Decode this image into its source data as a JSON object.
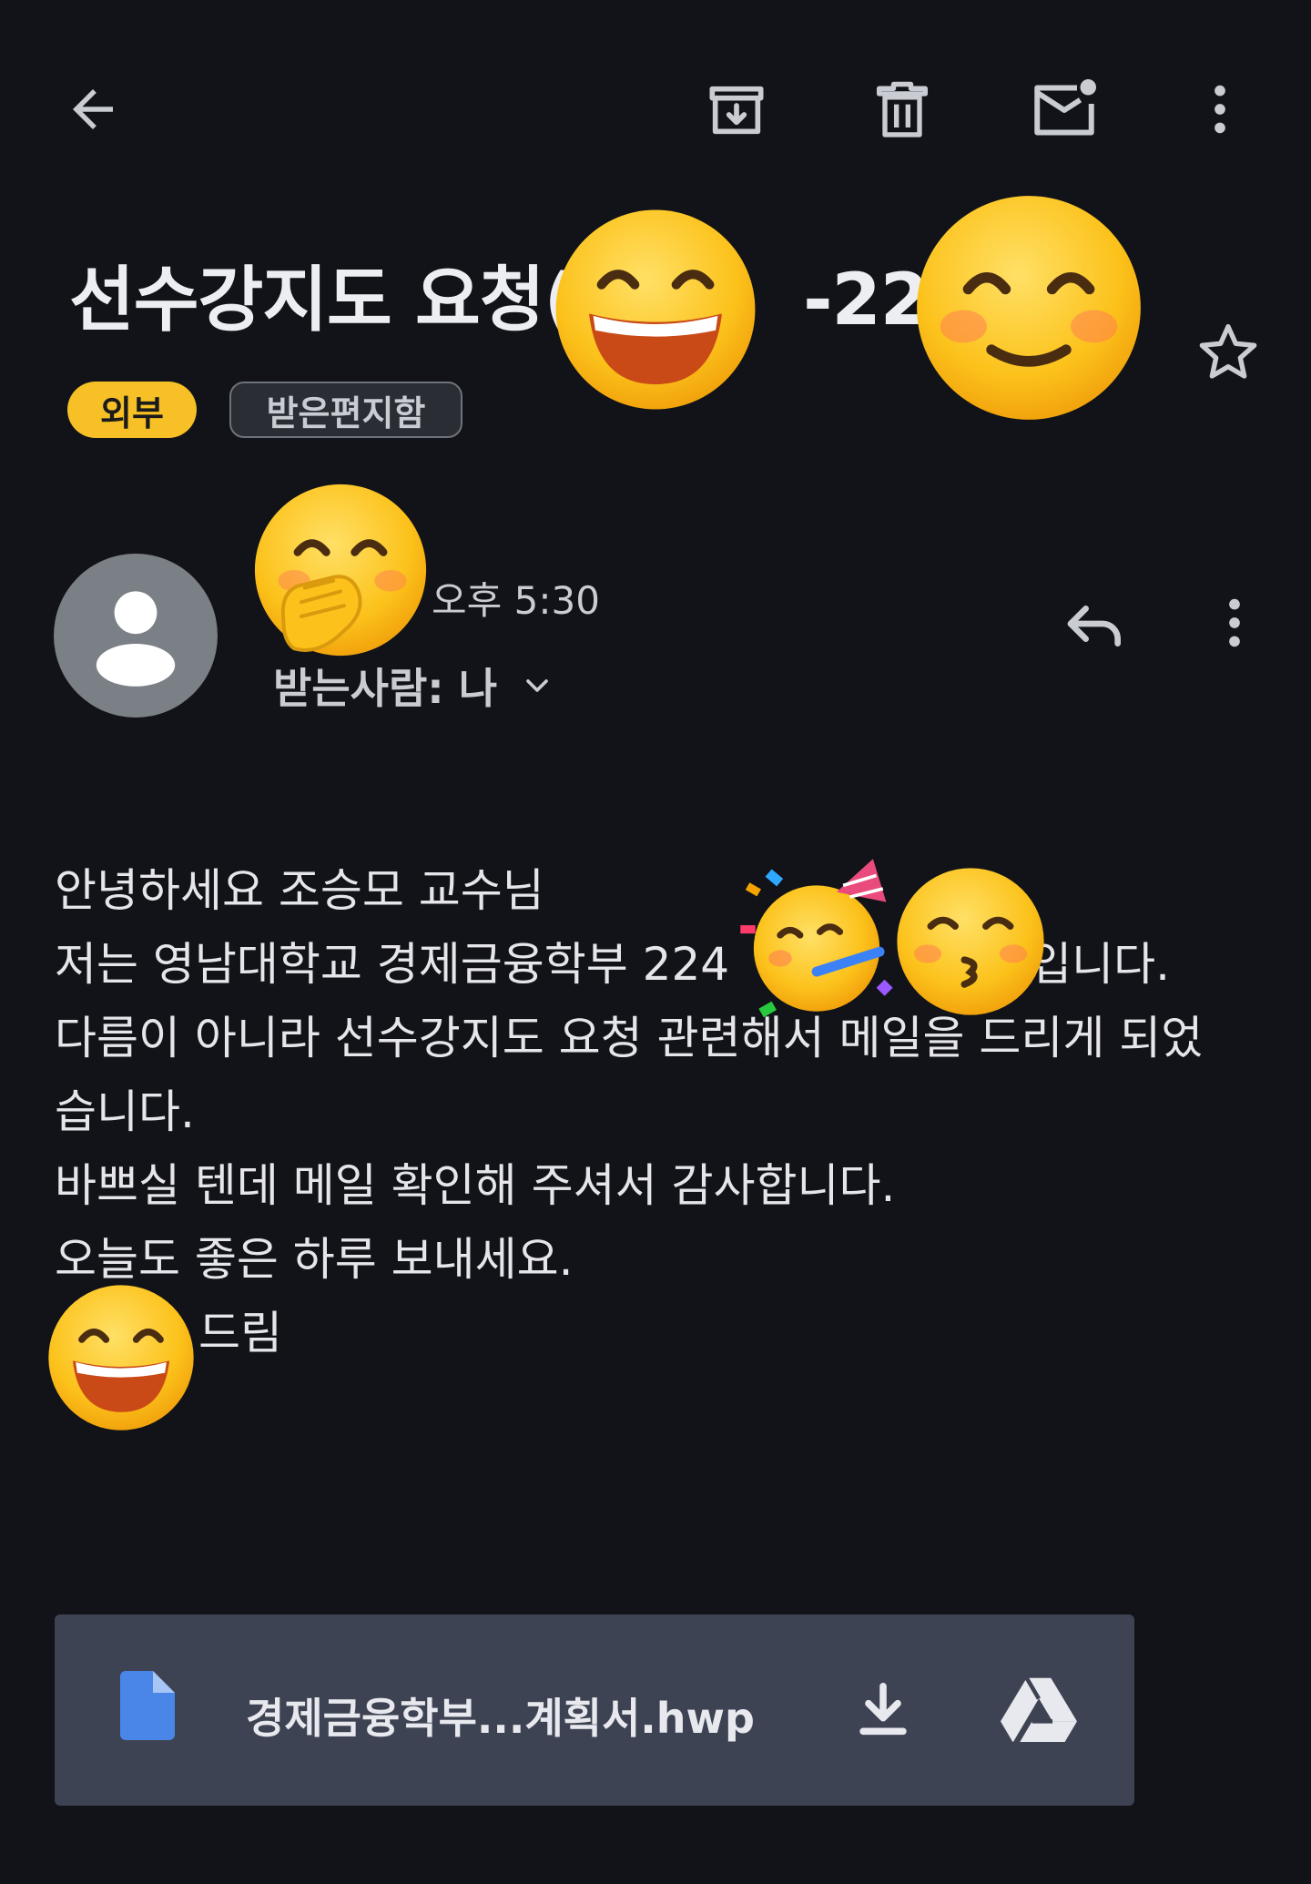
{
  "toolbar": {
    "back": "back-arrow-icon",
    "archive": "archive-icon",
    "delete": "trash-icon",
    "mark_unread": "mark-unread-icon",
    "more": "more-vert-icon"
  },
  "email": {
    "subject_part1": "선수강지도 요청(",
    "subject_part2": "-224",
    "chips": {
      "external": "외부",
      "inbox": "받은편지함"
    },
    "time": "오후 5:30",
    "recipient": "받는사람: 나",
    "body_lines": [
      "안녕하세요 조승모 교수님",
      "저는 영남대학교 경제금융학부 224",
      "입니다.",
      "다름이 아니라 선수강지도 요청 관련해서 메일을 드리게 되었",
      "습니다.",
      "바쁘실 텐데 메일 확인해 주셔서 감사합니다.",
      "오늘도 좋은 하루 보내세요.",
      "드림"
    ],
    "attachment": {
      "filename": "경제금융학부...계획서.hwp"
    }
  },
  "colors": {
    "background": "#111318",
    "external_chip": "#f6c026",
    "attachment_bg": "#3d4352",
    "file_icon": "#4a86e8"
  }
}
